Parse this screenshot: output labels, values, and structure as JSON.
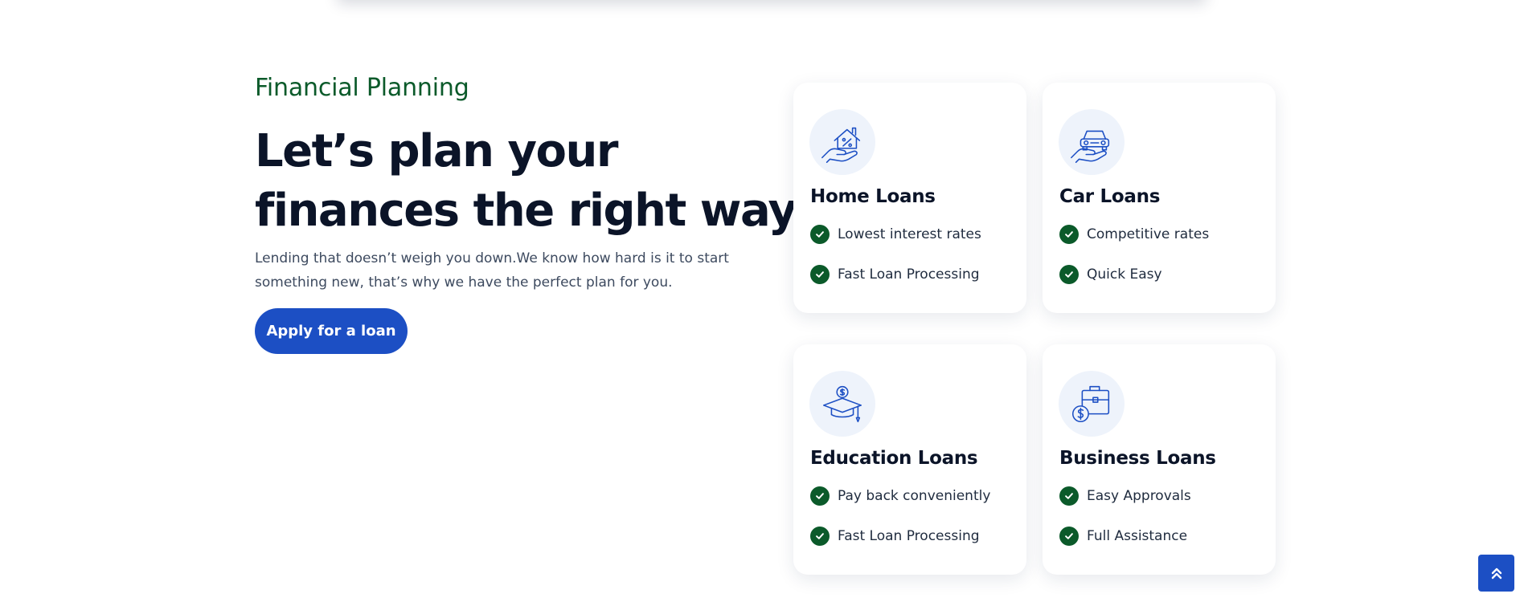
{
  "hero": {
    "eyebrow": "Financial Planning",
    "headline_line1": "Let’s plan your",
    "headline_line2": "finances the right way",
    "lead": "Lending that doesn’t weigh you down.We know how hard is it to start something new, that’s why we have the perfect plan for you.",
    "apply_label": "Apply for a loan"
  },
  "cards": [
    {
      "icon": "home-loan-icon",
      "title": "Home Loans",
      "features": [
        "Lowest interest rates",
        "Fast Loan Processing"
      ]
    },
    {
      "icon": "car-loan-icon",
      "title": "Car Loans",
      "features": [
        "Competitive rates",
        "Quick Easy"
      ]
    },
    {
      "icon": "education-loan-icon",
      "title": "Education Loans",
      "features": [
        "Pay back conveniently",
        "Fast Loan Processing"
      ]
    },
    {
      "icon": "business-loan-icon",
      "title": "Business Loans",
      "features": [
        "Easy Approvals",
        "Full Assistance"
      ]
    }
  ],
  "scroll_top": {
    "icon": "double-chevron-up-icon"
  },
  "colors": {
    "brand_blue": "#1c4fc4",
    "accent_green": "#0b5a2a",
    "heading": "#0b1428",
    "body_text": "#3d4a5f",
    "icon_bg": "#eef3fb"
  }
}
